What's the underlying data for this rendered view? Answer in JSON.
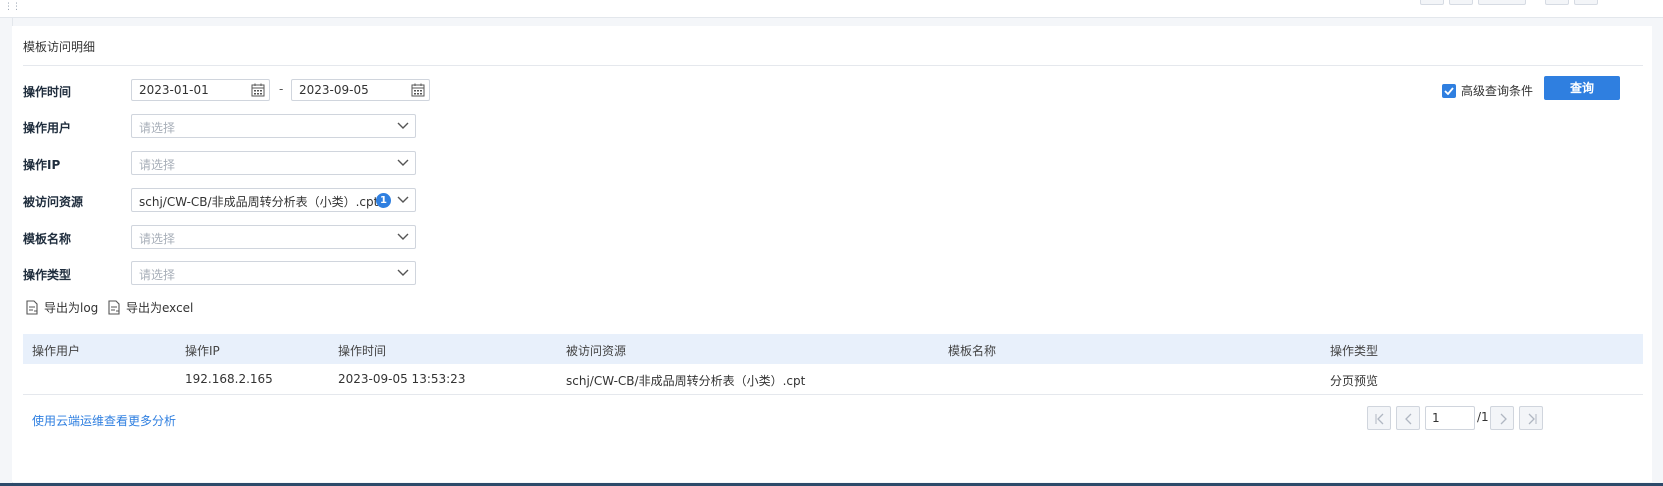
{
  "panel": {
    "title": "模板访问明细"
  },
  "filters": {
    "op_time": {
      "label": "操作时间",
      "start": "2023-01-01",
      "end": "2023-09-05",
      "separator": "-"
    },
    "op_user": {
      "label": "操作用户",
      "placeholder": "请选择"
    },
    "op_ip": {
      "label": "操作IP",
      "placeholder": "请选择"
    },
    "resource": {
      "label": "被访问资源",
      "value": "schj/CW-CB/非成品周转分析表（小类）.cpt",
      "badge": "1"
    },
    "template_name": {
      "label": "模板名称",
      "placeholder": "请选择"
    },
    "op_type": {
      "label": "操作类型",
      "placeholder": "请选择"
    }
  },
  "advanced": {
    "label": "高级查询条件",
    "checked": true
  },
  "query_button": "查询",
  "exports": {
    "log": "导出为log",
    "excel": "导出为excel"
  },
  "table": {
    "headers": [
      "操作用户",
      "操作IP",
      "操作时间",
      "被访问资源",
      "模板名称",
      "操作类型"
    ],
    "rows": [
      [
        "",
        "192.168.2.165",
        "2023-09-05 13:53:23",
        "schj/CW-CB/非成品周转分析表（小类）.cpt",
        "",
        "分页预览"
      ]
    ]
  },
  "footer": {
    "more_link": "使用云端运维查看更多分析"
  },
  "pager": {
    "current": "1",
    "total": "/1"
  },
  "colors": {
    "accent": "#2f7fe0",
    "header_bg": "#e8f0fb"
  }
}
